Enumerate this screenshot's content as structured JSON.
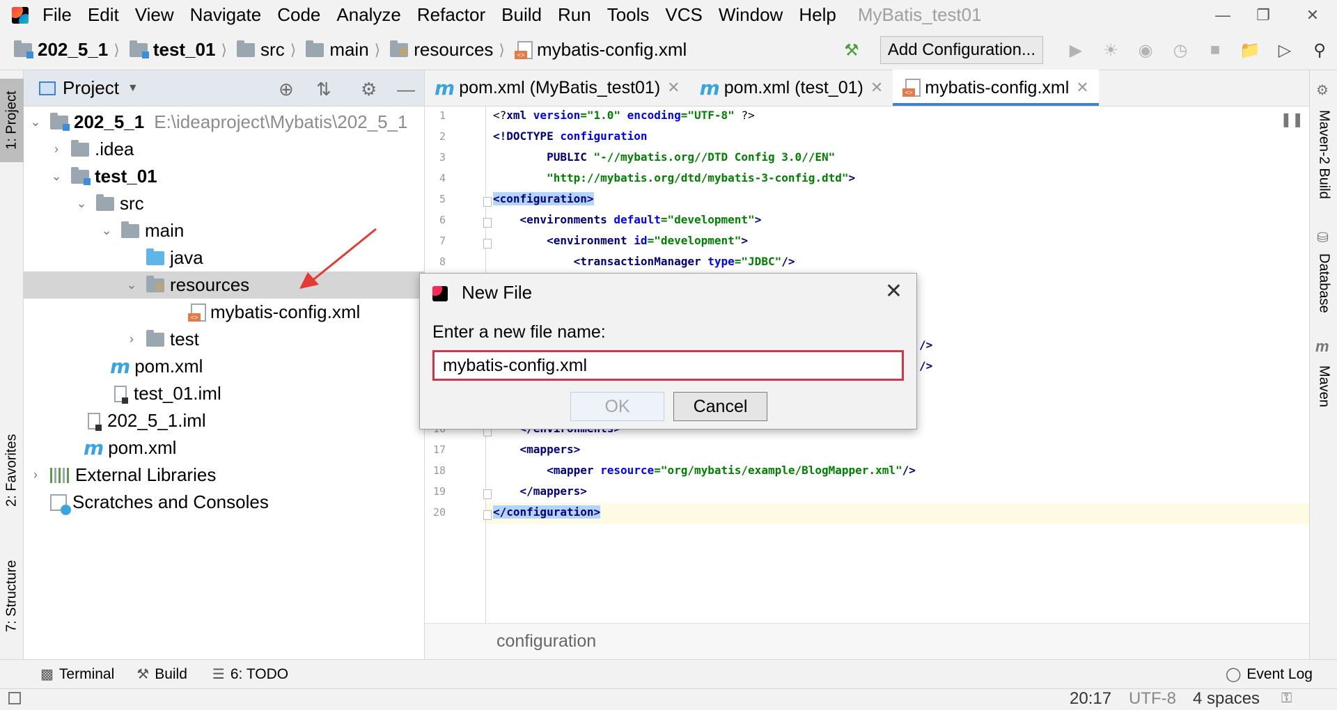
{
  "menubar": {
    "items": [
      "File",
      "Edit",
      "View",
      "Navigate",
      "Code",
      "Analyze",
      "Refactor",
      "Build",
      "Run",
      "Tools",
      "VCS",
      "Window",
      "Help"
    ],
    "window_title": "MyBatis_test01"
  },
  "navbar": {
    "crumbs": [
      "202_5_1",
      "test_01",
      "src",
      "main",
      "resources",
      "mybatis-config.xml"
    ],
    "add_config": "Add Configuration..."
  },
  "left_strip": {
    "project": "1: Project",
    "favorites": "2: Favorites",
    "structure": "7: Structure"
  },
  "project_panel": {
    "title": "Project",
    "tree": [
      {
        "label": "202_5_1",
        "hint": "E:\\ideaproject\\Mybatis\\202_5_1"
      },
      {
        "label": ".idea"
      },
      {
        "label": "test_01"
      },
      {
        "label": "src"
      },
      {
        "label": "main"
      },
      {
        "label": "java"
      },
      {
        "label": "resources"
      },
      {
        "label": "mybatis-config.xml"
      },
      {
        "label": "test"
      },
      {
        "label": "pom.xml"
      },
      {
        "label": "test_01.iml"
      },
      {
        "label": "202_5_1.iml"
      },
      {
        "label": "pom.xml"
      },
      {
        "label": "External Libraries"
      },
      {
        "label": "Scratches and Consoles"
      }
    ]
  },
  "editor": {
    "tabs": [
      "pom.xml (MyBatis_test01)",
      "pom.xml (test_01)",
      "mybatis-config.xml"
    ],
    "line_numbers": [
      "1",
      "2",
      "3",
      "4",
      "5",
      "6",
      "7",
      "8",
      "16",
      "17",
      "18",
      "19",
      "20"
    ],
    "breadcrumb": "configuration"
  },
  "dialog": {
    "title": "New File",
    "prompt": "Enter a new file name:",
    "value": "mybatis-config.xml",
    "ok": "OK",
    "cancel": "Cancel"
  },
  "right_strip": {
    "maven2": "Maven-2 Build",
    "database": "Database",
    "maven": "Maven"
  },
  "bottom_bar": {
    "terminal": "Terminal",
    "build": "Build",
    "todo": "6: TODO",
    "event_log": "Event Log"
  },
  "status_bar": {
    "position": "20:17",
    "encoding": "UTF-8",
    "indent": "4 spaces"
  },
  "colors": {
    "accent": "#4083c9",
    "highlight": "#b3d4fc",
    "input_border": "#d7334a",
    "arrow": "#e53935"
  }
}
